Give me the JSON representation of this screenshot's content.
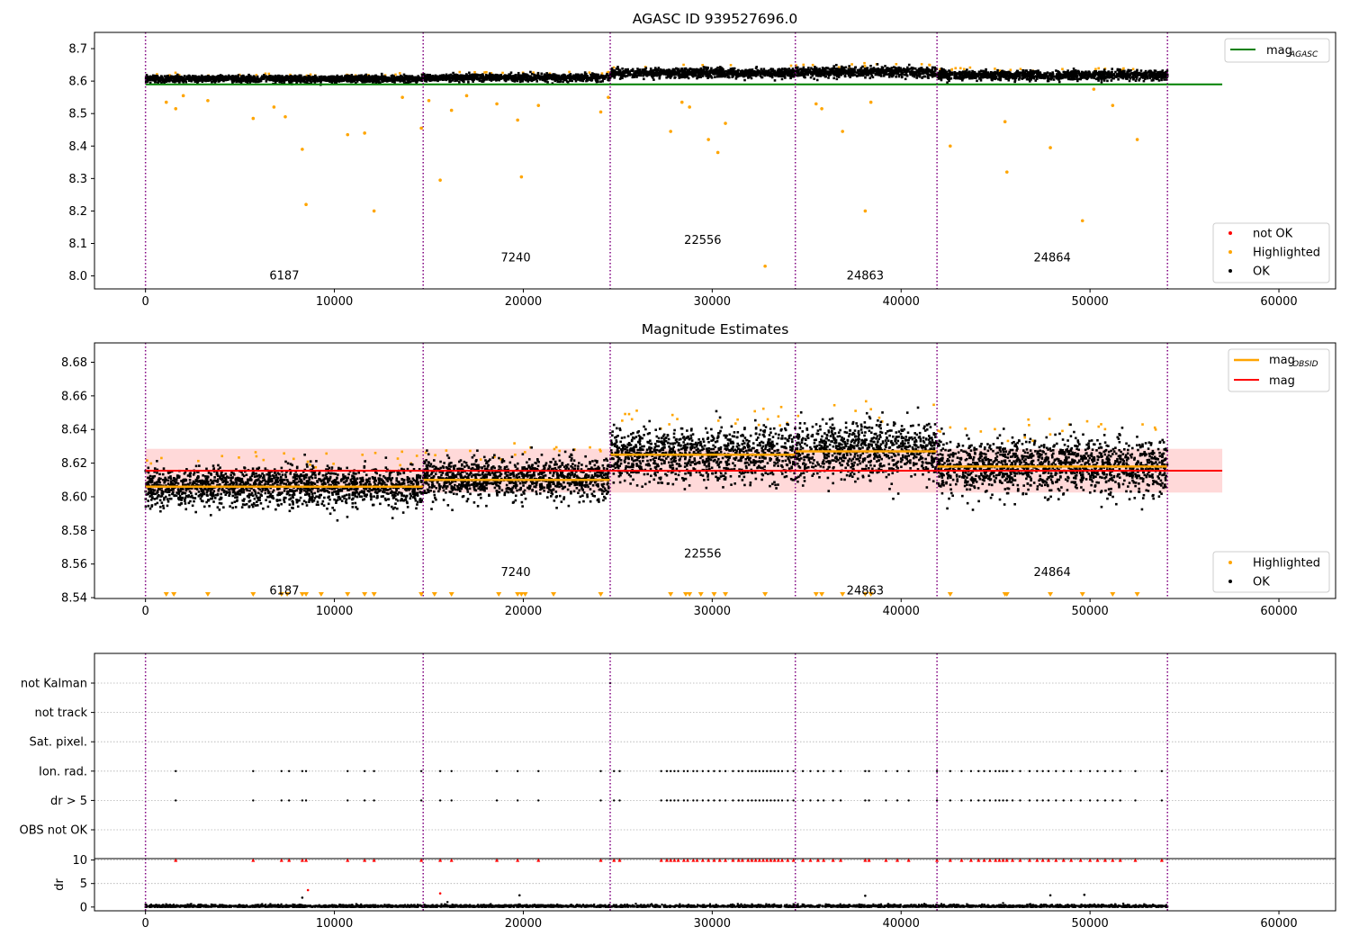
{
  "colors": {
    "agasc_line": "#008000",
    "obsid_line": "#ffa500",
    "mag_line": "#ff0000",
    "band": "#ffcccc",
    "highlighted": "#ffa500",
    "ok": "#000000",
    "not_ok": "#ff0000",
    "obs_boundary": "#800080"
  },
  "chart_data": [
    {
      "type": "scatter",
      "title": "AGASC ID 939527696.0",
      "xlabel": "",
      "ylabel": "",
      "xlim": [
        -2700,
        63000
      ],
      "ylim": [
        7.96,
        8.75
      ],
      "x_ticks": [
        0,
        10000,
        20000,
        30000,
        40000,
        50000,
        60000
      ],
      "y_ticks": [
        8.0,
        8.1,
        8.2,
        8.3,
        8.4,
        8.5,
        8.6,
        8.7
      ],
      "y_tick_labels": [
        "8.0",
        "8.1",
        "8.2",
        "8.3",
        "8.4",
        "8.5",
        "8.6",
        "8.7"
      ],
      "obs_boundaries": [
        0,
        14700,
        24600,
        34400,
        41900,
        54100
      ],
      "obsids": [
        {
          "label": "6187",
          "x": 7350,
          "y": 8.0
        },
        {
          "label": "7240",
          "x": 19600,
          "y": 8.055
        },
        {
          "label": "22556",
          "x": 29500,
          "y": 8.11
        },
        {
          "label": "24863",
          "x": 38100,
          "y": 8.0
        },
        {
          "label": "24864",
          "x": 48000,
          "y": 8.055
        }
      ],
      "segments": [
        {
          "x": [
            0,
            14700
          ],
          "center": 8.607,
          "spread": 0.011
        },
        {
          "x": [
            14700,
            24600
          ],
          "center": 8.611,
          "spread": 0.011
        },
        {
          "x": [
            24600,
            34400
          ],
          "center": 8.625,
          "spread": 0.015
        },
        {
          "x": [
            34400,
            41900
          ],
          "center": 8.628,
          "spread": 0.016
        },
        {
          "x": [
            41900,
            54100
          ],
          "center": 8.618,
          "spread": 0.015
        }
      ],
      "agasc_mag": {
        "value": 8.59,
        "x": [
          0,
          57000
        ]
      },
      "highlighted_outliers": [
        [
          1100,
          8.535
        ],
        [
          1600,
          8.515
        ],
        [
          2000,
          8.555
        ],
        [
          3300,
          8.54
        ],
        [
          5700,
          8.485
        ],
        [
          6800,
          8.52
        ],
        [
          7400,
          8.49
        ],
        [
          8300,
          8.39
        ],
        [
          8500,
          8.22
        ],
        [
          10700,
          8.435
        ],
        [
          11600,
          8.44
        ],
        [
          12100,
          8.2
        ],
        [
          13600,
          8.55
        ],
        [
          14600,
          8.455
        ],
        [
          15000,
          8.54
        ],
        [
          15600,
          8.295
        ],
        [
          16200,
          8.51
        ],
        [
          17000,
          8.555
        ],
        [
          18600,
          8.53
        ],
        [
          19700,
          8.48
        ],
        [
          19900,
          8.305
        ],
        [
          20800,
          8.525
        ],
        [
          24100,
          8.505
        ],
        [
          24500,
          8.55
        ],
        [
          27800,
          8.445
        ],
        [
          28400,
          8.535
        ],
        [
          28800,
          8.52
        ],
        [
          29800,
          8.42
        ],
        [
          30300,
          8.38
        ],
        [
          30700,
          8.47
        ],
        [
          32800,
          8.03
        ],
        [
          35500,
          8.53
        ],
        [
          35800,
          8.515
        ],
        [
          36900,
          8.445
        ],
        [
          38100,
          8.2
        ],
        [
          38400,
          8.535
        ],
        [
          42600,
          8.4
        ],
        [
          45500,
          8.475
        ],
        [
          45600,
          8.32
        ],
        [
          47900,
          8.395
        ],
        [
          49600,
          8.17
        ],
        [
          50200,
          8.575
        ],
        [
          51200,
          8.525
        ],
        [
          52500,
          8.42
        ]
      ],
      "legend": {
        "position": "top-right",
        "entries": [
          {
            "label": "mag",
            "sub": "AGASC",
            "kind": "line",
            "color": "#008000"
          }
        ]
      },
      "legend2": {
        "position": "bottom-right",
        "entries": [
          {
            "label": "not OK",
            "kind": "dot",
            "color": "#ff0000"
          },
          {
            "label": "Highlighted",
            "kind": "dot",
            "color": "#ffa500"
          },
          {
            "label": "OK",
            "kind": "dot",
            "color": "#000000"
          }
        ]
      }
    },
    {
      "type": "scatter",
      "title": "Magnitude Estimates",
      "xlabel": "",
      "ylabel": "",
      "xlim": [
        -2700,
        63000
      ],
      "ylim": [
        8.5395,
        8.6915
      ],
      "x_ticks": [
        0,
        10000,
        20000,
        30000,
        40000,
        50000,
        60000
      ],
      "y_ticks": [
        8.54,
        8.56,
        8.58,
        8.6,
        8.62,
        8.64,
        8.66,
        8.68
      ],
      "y_tick_labels": [
        "8.54",
        "8.56",
        "8.58",
        "8.60",
        "8.62",
        "8.64",
        "8.66",
        "8.68"
      ],
      "obs_boundaries": [
        0,
        14700,
        24600,
        34400,
        41900,
        54100
      ],
      "obsids": [
        {
          "label": "6187",
          "x": 7350,
          "y": 8.544
        },
        {
          "label": "7240",
          "x": 19600,
          "y": 8.555
        },
        {
          "label": "22556",
          "x": 29500,
          "y": 8.566
        },
        {
          "label": "24863",
          "x": 38100,
          "y": 8.544
        },
        {
          "label": "24864",
          "x": 48000,
          "y": 8.555
        }
      ],
      "segments": [
        {
          "x": [
            0,
            14700
          ],
          "mean": 8.606,
          "center": 8.606,
          "spread": 0.011
        },
        {
          "x": [
            14700,
            24600
          ],
          "mean": 8.61,
          "center": 8.611,
          "spread": 0.011
        },
        {
          "x": [
            24600,
            34400
          ],
          "mean": 8.625,
          "center": 8.625,
          "spread": 0.015
        },
        {
          "x": [
            34400,
            41900
          ],
          "mean": 8.627,
          "center": 8.628,
          "spread": 0.016
        },
        {
          "x": [
            41900,
            54100
          ],
          "mean": 8.618,
          "center": 8.618,
          "spread": 0.015
        }
      ],
      "mag": {
        "value": 8.6155,
        "band": [
          8.6025,
          8.6285
        ],
        "x": [
          0,
          57000
        ]
      },
      "mag_obsid_label": "mag",
      "mag_obsid_sub": "OBSID",
      "mag_label": "mag",
      "low_markers_x": [
        1100,
        1500,
        3300,
        5700,
        7200,
        7500,
        8300,
        8500,
        9300,
        10700,
        11600,
        12100,
        14600,
        15300,
        16200,
        18700,
        19700,
        19900,
        20100,
        21600,
        24100,
        27800,
        28600,
        28800,
        29400,
        30100,
        30700,
        32800,
        35500,
        35800,
        36900,
        38100,
        38400,
        42600,
        45500,
        45600,
        47900,
        49600,
        51200,
        52500
      ],
      "legend": {
        "position": "top-right",
        "entries": [
          {
            "label": "mag",
            "sub": "OBSID",
            "kind": "line",
            "color": "#ffa500"
          },
          {
            "label": "mag",
            "kind": "line",
            "color": "#ff0000"
          }
        ]
      },
      "legend2": {
        "position": "bottom-right",
        "entries": [
          {
            "label": "Highlighted",
            "kind": "dot",
            "color": "#ffa500"
          },
          {
            "label": "OK",
            "kind": "dot",
            "color": "#000000"
          }
        ]
      }
    },
    {
      "type": "scatter",
      "title": "",
      "xlabel": "",
      "ylabel": "",
      "xlim": [
        -2700,
        63000
      ],
      "categories": [
        "not Kalman",
        "not track",
        "Sat. pixel.",
        "Ion. rad.",
        "dr > 5",
        "OBS not OK"
      ],
      "obs_boundaries": [
        0,
        14700,
        24600,
        34400,
        41900,
        54100
      ],
      "flag_x": [
        1600,
        5700,
        7200,
        7600,
        8300,
        8500,
        10700,
        11600,
        12100,
        14600,
        15600,
        16200,
        18600,
        19700,
        20800,
        24100,
        24800,
        25100,
        27300,
        27600,
        27800,
        28000,
        28200,
        28500,
        28700,
        29000,
        29200,
        29500,
        29800,
        30100,
        30400,
        30700,
        31100,
        31400,
        31600,
        31900,
        32100,
        32300,
        32500,
        32700,
        32900,
        33100,
        33300,
        33500,
        33700,
        34000,
        34300,
        34800,
        35200,
        35600,
        35900,
        36400,
        36800,
        38100,
        38300,
        39200,
        39800,
        40400,
        41900,
        42600,
        43200,
        43700,
        44100,
        44400,
        44700,
        45000,
        45200,
        45400,
        45600,
        45900,
        46300,
        46800,
        47200,
        47500,
        47800,
        48200,
        48600,
        49000,
        49500,
        50000,
        50400,
        50800,
        51200,
        51600,
        52400,
        53800
      ],
      "not_kalman_x": [
        24600
      ]
    },
    {
      "type": "scatter",
      "title": "",
      "xlabel": "",
      "ylabel": "dr",
      "xlim": [
        -2700,
        63000
      ],
      "ylim": [
        -0.8,
        10.3
      ],
      "y_ticks": [
        0,
        5,
        10
      ],
      "y_tick_labels": [
        "0",
        "5",
        "10"
      ],
      "x_ticks": [
        0,
        10000,
        20000,
        30000,
        40000,
        50000,
        60000
      ],
      "obs_boundaries": [
        0,
        14700,
        24600,
        34400,
        41900,
        54100
      ],
      "clipped_marker_y": 10,
      "clipped_x": [
        1600,
        5700,
        7200,
        7600,
        8300,
        8500,
        10700,
        11600,
        12100,
        14600,
        15600,
        16200,
        18600,
        19700,
        20800,
        24100,
        24800,
        25100,
        27300,
        27600,
        27800,
        28000,
        28200,
        28500,
        28700,
        29000,
        29200,
        29500,
        29800,
        30100,
        30400,
        30700,
        31100,
        31400,
        31600,
        31900,
        32100,
        32300,
        32500,
        32700,
        32900,
        33100,
        33300,
        33500,
        33700,
        34000,
        34300,
        34800,
        35200,
        35600,
        35900,
        36400,
        36800,
        38100,
        38300,
        39200,
        39800,
        40400,
        41900,
        42600,
        43200,
        43700,
        44100,
        44400,
        44700,
        45000,
        45200,
        45400,
        45600,
        45900,
        46300,
        46800,
        47200,
        47500,
        47800,
        48200,
        48600,
        49000,
        49500,
        50000,
        50400,
        50800,
        51200,
        51600,
        52400,
        53800
      ],
      "red_points": [
        [
          8600,
          3.6
        ],
        [
          15600,
          2.9
        ]
      ],
      "black_high_points": [
        [
          19800,
          2.5
        ],
        [
          38100,
          2.4
        ],
        [
          47900,
          2.5
        ],
        [
          49700,
          2.6
        ],
        [
          8300,
          2.0
        ]
      ]
    }
  ]
}
